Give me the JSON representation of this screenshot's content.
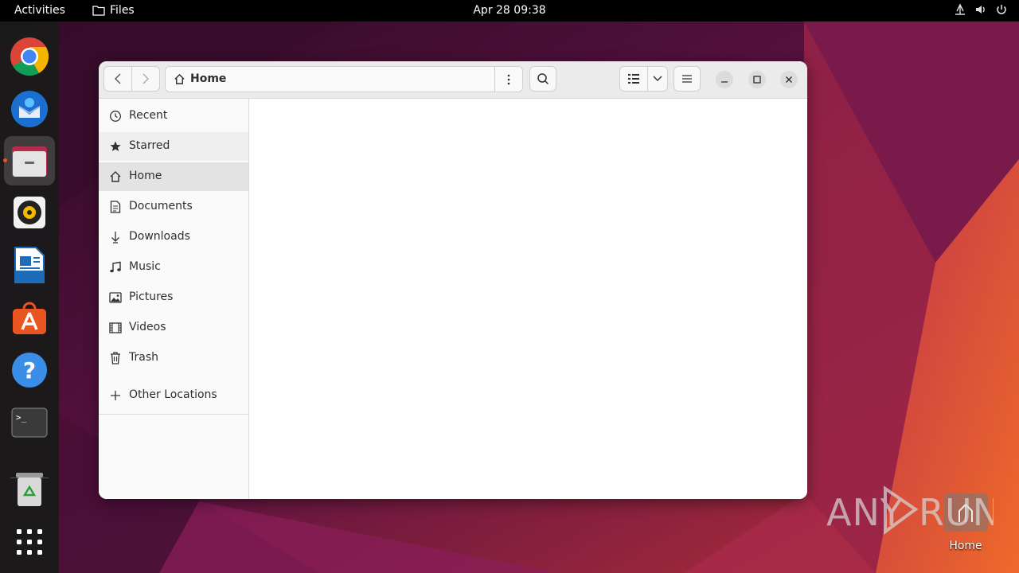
{
  "topbar": {
    "activities": "Activities",
    "app_name": "Files",
    "clock": "Apr 28  09:38",
    "tray_icons": [
      "network-icon",
      "volume-icon",
      "power-icon"
    ]
  },
  "dock": {
    "apps": [
      {
        "name": "chrome",
        "icon": "chrome-icon"
      },
      {
        "name": "thunderbird",
        "icon": "thunderbird-icon"
      },
      {
        "name": "files",
        "icon": "files-icon",
        "active": true
      },
      {
        "name": "rhythmbox",
        "icon": "rhythmbox-icon"
      },
      {
        "name": "libreoffice-writer",
        "icon": "writer-icon"
      },
      {
        "name": "app-center",
        "icon": "app-store-icon"
      },
      {
        "name": "help",
        "icon": "help-icon",
        "glyph": "?"
      },
      {
        "name": "terminal",
        "icon": "terminal-icon",
        "glyph": ">_"
      },
      {
        "name": "trash",
        "icon": "trash-icon"
      },
      {
        "name": "show-apps",
        "icon": "apps-grid-icon"
      }
    ]
  },
  "window": {
    "path": "Home",
    "sidebar": {
      "items": [
        {
          "label": "Recent",
          "icon": "clock-icon"
        },
        {
          "label": "Starred",
          "icon": "star-icon"
        },
        {
          "label": "Home",
          "icon": "home-icon"
        },
        {
          "label": "Documents",
          "icon": "document-icon"
        },
        {
          "label": "Downloads",
          "icon": "download-icon"
        },
        {
          "label": "Music",
          "icon": "music-icon"
        },
        {
          "label": "Pictures",
          "icon": "picture-icon"
        },
        {
          "label": "Videos",
          "icon": "video-icon"
        },
        {
          "label": "Trash",
          "icon": "trash-icon"
        }
      ],
      "other": {
        "label": "Other Locations",
        "icon": "plus-icon"
      }
    }
  },
  "desktop": {
    "icon_label": "Home"
  },
  "watermark": "ANY RUN",
  "colors": {
    "accent": "#e95420",
    "topbar": "#000000",
    "dock": "#1a1a1a",
    "wallpaper_dark": "#3a0c2c",
    "wallpaper_orange": "#e8602c"
  }
}
